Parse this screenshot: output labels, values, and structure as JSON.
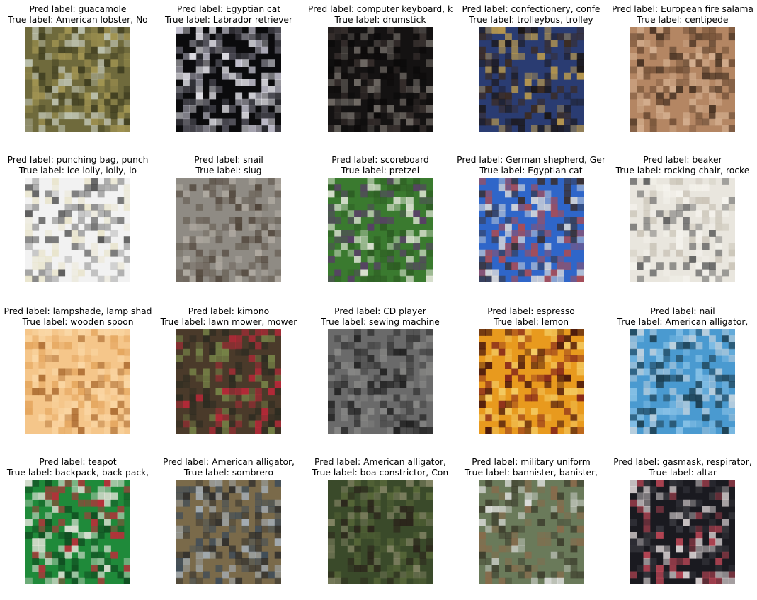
{
  "figure": {
    "pred_prefix": "Pred label: ",
    "true_prefix": "True label: ",
    "items": [
      {
        "pred": "guacamole",
        "true": "American lobster, No",
        "image": "grassy-ravine",
        "colors": [
          "#6f6a3c",
          "#a89a55",
          "#3b3a1e",
          "#c4c9b9"
        ]
      },
      {
        "pred": "Egyptian cat",
        "true": "Labrador retriever",
        "image": "dog-in-dark-circle",
        "colors": [
          "#0b0b0d",
          "#d9d7e6",
          "#5a5963",
          "#f5f4fb"
        ]
      },
      {
        "pred": "computer keyboard, k",
        "true": "drumstick",
        "image": "dark-drum-kit",
        "colors": [
          "#141212",
          "#3a3230",
          "#7a746e",
          "#0a0909"
        ]
      },
      {
        "pred": "confectionery, confe",
        "true": "trolleybus, trolley",
        "image": "yellow-bus-night",
        "colors": [
          "#2a3c72",
          "#c7a24a",
          "#3d2a1c",
          "#1a1410"
        ]
      },
      {
        "pred": "European fire salama",
        "true": "centipede",
        "image": "brown-reptile",
        "colors": [
          "#b48663",
          "#6b4a32",
          "#d7b394",
          "#3d2a1c"
        ]
      },
      {
        "pred": "punching bag, punch",
        "true": "ice lolly, lolly, lo",
        "image": "popsicle-window",
        "colors": [
          "#f2f2f2",
          "#4a4a4a",
          "#e8e3c8",
          "#9a9a9a"
        ]
      },
      {
        "pred": "snail",
        "true": "slug",
        "image": "slug-on-concrete",
        "colors": [
          "#8f8b84",
          "#b3ada4",
          "#4a3e33",
          "#6e665c"
        ]
      },
      {
        "pred": "scoreboard",
        "true": "pretzel",
        "image": "pretzel-bag",
        "colors": [
          "#3a7a2f",
          "#f0efe6",
          "#5b3a6b",
          "#2c5a22"
        ]
      },
      {
        "pred": "German shepherd, Ger",
        "true": "Egyptian cat",
        "image": "cat-on-blue",
        "colors": [
          "#2f66c9",
          "#e8e4dc",
          "#3b2b22",
          "#b54a4a"
        ]
      },
      {
        "pred": "beaker",
        "true": "rocking chair, rocke",
        "image": "porch-chairs",
        "colors": [
          "#e9e6de",
          "#c8c2b5",
          "#5a5a5a",
          "#f6f4ee"
        ]
      },
      {
        "pred": "lampshade, lamp shad",
        "true": "wooden spoon",
        "image": "wooden-spoon",
        "colors": [
          "#f5c68a",
          "#e3a35a",
          "#a9682d",
          "#fbd9a8"
        ]
      },
      {
        "pred": "kimono",
        "true": "lawn mower, mower",
        "image": "person-gardening",
        "colors": [
          "#4a3a2a",
          "#c8263a",
          "#7a8a4a",
          "#2a2a20"
        ]
      },
      {
        "pred": "CD player",
        "true": "sewing machine",
        "image": "black-sewing-machine",
        "colors": [
          "#6a6a6a",
          "#1a1a1a",
          "#8a8a88",
          "#3a3a3a"
        ]
      },
      {
        "pred": "espresso",
        "true": "lemon",
        "image": "lemon-book-cover",
        "colors": [
          "#e89a1e",
          "#7a1a1a",
          "#f5d06a",
          "#3a0a0a"
        ]
      },
      {
        "pred": "nail",
        "true": "American alligator,",
        "image": "blue-water-scene",
        "colors": [
          "#4a9ad0",
          "#8cc4e8",
          "#1a3a4a",
          "#c8d6e0"
        ]
      },
      {
        "pred": "teapot",
        "true": "backpack, back pack,",
        "image": "green-frog-backpack",
        "colors": [
          "#1f8a3a",
          "#c8263a",
          "#e9e6de",
          "#0f4a1f"
        ]
      },
      {
        "pred": "American alligator,",
        "true": "sombrero",
        "image": "sombrero-on-rocks",
        "colors": [
          "#7a6a4a",
          "#3a4a5a",
          "#a8b4c0",
          "#2a2a2a"
        ]
      },
      {
        "pred": "American alligator,",
        "true": "boa constrictor, Con",
        "image": "snake-in-tree",
        "colors": [
          "#3a4a2a",
          "#5a6a3a",
          "#2a221a",
          "#8a8a6a"
        ]
      },
      {
        "pred": "military uniform",
        "true": "bannister, banister,",
        "image": "skateboarder-stairs",
        "colors": [
          "#6a7a5a",
          "#e8e8e8",
          "#3a3a2a",
          "#8a6a4a"
        ]
      },
      {
        "pred": "gasmask, respirator,",
        "true": "altar",
        "image": "dark-church-altar",
        "colors": [
          "#1a1a20",
          "#c84a5a",
          "#e8e0e0",
          "#3a3a40"
        ]
      }
    ]
  }
}
